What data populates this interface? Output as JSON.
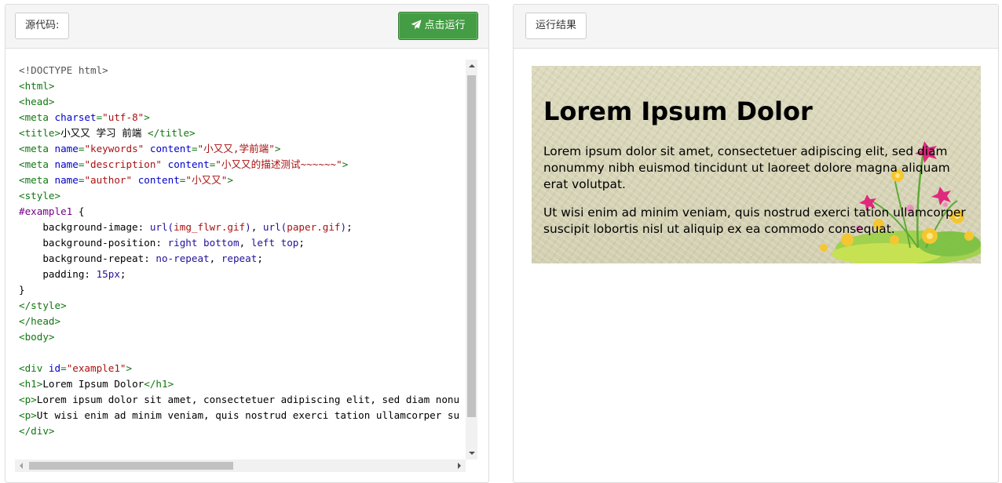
{
  "left_panel": {
    "label": "源代码:",
    "run_button": "点击运行",
    "code_lines": [
      [
        {
          "t": "meta",
          "v": "<!DOCTYPE html>"
        }
      ],
      [
        {
          "t": "tag",
          "v": "<html>"
        }
      ],
      [
        {
          "t": "tag",
          "v": "<head>"
        }
      ],
      [
        {
          "t": "tag",
          "v": "<meta "
        },
        {
          "t": "attr",
          "v": "charset"
        },
        {
          "t": "tag",
          "v": "="
        },
        {
          "t": "str",
          "v": "\"utf-8\""
        },
        {
          "t": "tag",
          "v": ">"
        }
      ],
      [
        {
          "t": "tag",
          "v": "<title>"
        },
        {
          "t": "txt",
          "v": "小又又 学习 前端 "
        },
        {
          "t": "tag",
          "v": "</title>"
        }
      ],
      [
        {
          "t": "tag",
          "v": "<meta "
        },
        {
          "t": "attr",
          "v": "name"
        },
        {
          "t": "tag",
          "v": "="
        },
        {
          "t": "str",
          "v": "\"keywords\""
        },
        {
          "t": "tag",
          "v": " "
        },
        {
          "t": "attr",
          "v": "content"
        },
        {
          "t": "tag",
          "v": "="
        },
        {
          "t": "str",
          "v": "\"小又又,学前端\""
        },
        {
          "t": "tag",
          "v": ">"
        }
      ],
      [
        {
          "t": "tag",
          "v": "<meta "
        },
        {
          "t": "attr",
          "v": "name"
        },
        {
          "t": "tag",
          "v": "="
        },
        {
          "t": "str",
          "v": "\"description\""
        },
        {
          "t": "tag",
          "v": " "
        },
        {
          "t": "attr",
          "v": "content"
        },
        {
          "t": "tag",
          "v": "="
        },
        {
          "t": "str",
          "v": "\"小又又的描述测试~~~~~~\""
        },
        {
          "t": "tag",
          "v": ">"
        }
      ],
      [
        {
          "t": "tag",
          "v": "<meta "
        },
        {
          "t": "attr",
          "v": "name"
        },
        {
          "t": "tag",
          "v": "="
        },
        {
          "t": "str",
          "v": "\"author\""
        },
        {
          "t": "tag",
          "v": " "
        },
        {
          "t": "attr",
          "v": "content"
        },
        {
          "t": "tag",
          "v": "="
        },
        {
          "t": "str",
          "v": "\"小又又\""
        },
        {
          "t": "tag",
          "v": ">"
        }
      ],
      [
        {
          "t": "tag",
          "v": "<style>"
        }
      ],
      [
        {
          "t": "sel",
          "v": "#example1"
        },
        {
          "t": "prop",
          "v": " {"
        }
      ],
      [
        {
          "t": "prop",
          "v": "    background-image: "
        },
        {
          "t": "val",
          "v": "url("
        },
        {
          "t": "str",
          "v": "img_flwr.gif"
        },
        {
          "t": "val",
          "v": ")"
        },
        {
          "t": "prop",
          "v": ", "
        },
        {
          "t": "val",
          "v": "url("
        },
        {
          "t": "str",
          "v": "paper.gif"
        },
        {
          "t": "val",
          "v": ")"
        },
        {
          "t": "prop",
          "v": ";"
        }
      ],
      [
        {
          "t": "prop",
          "v": "    background-position: "
        },
        {
          "t": "val",
          "v": "right bottom"
        },
        {
          "t": "prop",
          "v": ", "
        },
        {
          "t": "val",
          "v": "left top"
        },
        {
          "t": "prop",
          "v": ";"
        }
      ],
      [
        {
          "t": "prop",
          "v": "    background-repeat: "
        },
        {
          "t": "val",
          "v": "no-repeat"
        },
        {
          "t": "prop",
          "v": ", "
        },
        {
          "t": "val",
          "v": "repeat"
        },
        {
          "t": "prop",
          "v": ";"
        }
      ],
      [
        {
          "t": "prop",
          "v": "    padding: "
        },
        {
          "t": "val",
          "v": "15px"
        },
        {
          "t": "prop",
          "v": ";"
        }
      ],
      [
        {
          "t": "prop",
          "v": "}"
        }
      ],
      [
        {
          "t": "tag",
          "v": "</style>"
        }
      ],
      [
        {
          "t": "tag",
          "v": "</head>"
        }
      ],
      [
        {
          "t": "tag",
          "v": "<body>"
        }
      ],
      [],
      [
        {
          "t": "tag",
          "v": "<div "
        },
        {
          "t": "attr",
          "v": "id"
        },
        {
          "t": "tag",
          "v": "="
        },
        {
          "t": "str",
          "v": "\"example1\""
        },
        {
          "t": "tag",
          "v": ">"
        }
      ],
      [
        {
          "t": "tag",
          "v": "<h1>"
        },
        {
          "t": "txt",
          "v": "Lorem Ipsum Dolor"
        },
        {
          "t": "tag",
          "v": "</h1>"
        }
      ],
      [
        {
          "t": "tag",
          "v": "<p>"
        },
        {
          "t": "txt",
          "v": "Lorem ipsum dolor sit amet, consectetuer adipiscing elit, sed diam nonu"
        }
      ],
      [
        {
          "t": "tag",
          "v": "<p>"
        },
        {
          "t": "txt",
          "v": "Ut wisi enim ad minim veniam, quis nostrud exerci tation ullamcorper su"
        }
      ],
      [
        {
          "t": "tag",
          "v": "</div>"
        }
      ]
    ]
  },
  "right_panel": {
    "label": "运行结果",
    "heading": "Lorem Ipsum Dolor",
    "paragraphs": [
      "Lorem ipsum dolor sit amet, consectetuer adipiscing elit, sed diam nonummy nibh euismod tincidunt ut laoreet dolore magna aliquam erat volutpat.",
      "Ut wisi enim ad minim veniam, quis nostrud exerci tation ullamcorper suscipit lobortis nisl ut aliquip ex ea commodo consequat."
    ]
  },
  "colors": {
    "run_button_bg": "#449d44",
    "tag": "#117711",
    "attribute": "#0000cc",
    "string": "#aa1111",
    "selector": "#770088",
    "value": "#221199"
  },
  "icons": [
    "paper-plane-icon",
    "flower-decoration"
  ]
}
